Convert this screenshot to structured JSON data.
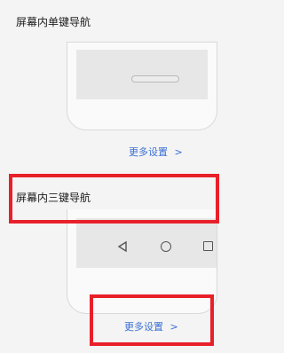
{
  "sections": [
    {
      "title": "屏幕内单键导航",
      "more_label": "更多设置",
      "more_chevron": ">"
    },
    {
      "title": "屏幕内三键导航",
      "more_label": "更多设置",
      "more_chevron": ">"
    }
  ],
  "colors": {
    "link": "#3b6fd4",
    "highlight": "#e8202a",
    "background": "#f4f4f4"
  },
  "icons": {
    "back": "back-triangle-icon",
    "home": "home-circle-icon",
    "recent": "recent-square-icon"
  }
}
